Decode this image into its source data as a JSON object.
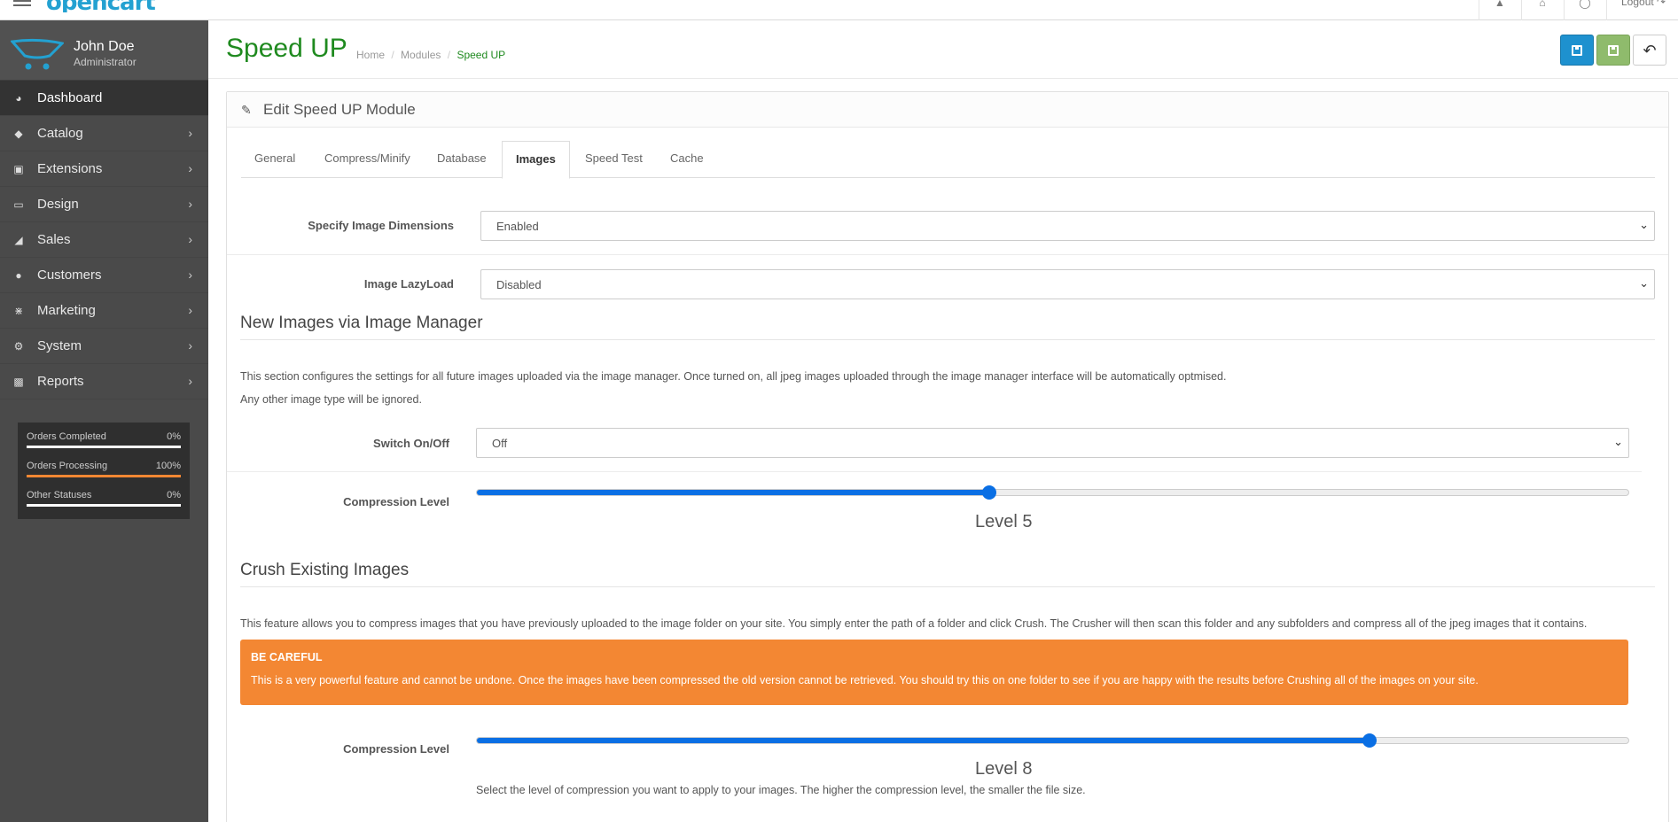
{
  "topbar": {
    "logo": "opencart",
    "logout_label": "Logout"
  },
  "profile": {
    "name": "John Doe",
    "role": "Administrator"
  },
  "sidebar": {
    "items": [
      {
        "label": "Dashboard",
        "icon": "dashboard-icon"
      },
      {
        "label": "Catalog",
        "icon": "tags-icon"
      },
      {
        "label": "Extensions",
        "icon": "puzzle-icon"
      },
      {
        "label": "Design",
        "icon": "desktop-icon"
      },
      {
        "label": "Sales",
        "icon": "cart-icon"
      },
      {
        "label": "Customers",
        "icon": "user-icon"
      },
      {
        "label": "Marketing",
        "icon": "share-icon"
      },
      {
        "label": "System",
        "icon": "gear-icon"
      },
      {
        "label": "Reports",
        "icon": "bar-chart-icon"
      }
    ],
    "stats": [
      {
        "label": "Orders Completed",
        "value": "0%",
        "progress": 0
      },
      {
        "label": "Orders Processing",
        "value": "100%",
        "progress": 100
      },
      {
        "label": "Other Statuses",
        "value": "0%",
        "progress": 0
      }
    ]
  },
  "header": {
    "title": "Speed UP",
    "breadcrumb": [
      "Home",
      "Modules",
      "Speed UP"
    ],
    "separator": "/"
  },
  "panel": {
    "title": "Edit Speed UP Module",
    "tabs": [
      "General",
      "Compress/Minify",
      "Database",
      "Images",
      "Speed Test",
      "Cache"
    ],
    "active_tab": "Images"
  },
  "form": {
    "dimensions_label": "Specify Image Dimensions",
    "dimensions_value": "Enabled",
    "lazyload_label": "Image LazyLoad",
    "lazyload_value": "Disabled"
  },
  "new_images": {
    "title": "New Images via Image Manager",
    "desc1": "This section configures the settings for all future images uploaded via the image manager. Once turned on, all jpeg images uploaded through the image manager interface will be automatically optmised.",
    "desc2": "Any other image type will be ignored.",
    "switch_label": "Switch On/Off",
    "switch_value": "Off",
    "compression_label": "Compression Level",
    "compression_level_text": "Level 5",
    "compression_fraction": 0.445
  },
  "crush": {
    "title": "Crush Existing Images",
    "desc": "This feature allows you to compress images that you have previously uploaded to the image folder on your site. You simply enter the path of a folder and click Crush. The Crusher will then scan this folder and any subfolders and compress all of the jpeg images that it contains.",
    "alert_title": "BE CAREFUL",
    "alert_text": "This is a very powerful feature and cannot be undone. Once the images have been compressed the old version cannot be retrieved. You should try this on one folder to see if you are happy with the results before Crushing all of the images on your site.",
    "compression_label": "Compression Level",
    "compression_level_text": "Level 8",
    "compression_fraction": 0.775,
    "help": "Select the level of compression you want to apply to your images. The higher the compression level, the smaller the file size."
  },
  "colors": {
    "title_green": "#1f8a1f",
    "primary_blue": "#1e91cf",
    "success_green": "#8fbb6c",
    "warning_orange": "#f38733",
    "slider_blue": "#0a6fe4"
  }
}
